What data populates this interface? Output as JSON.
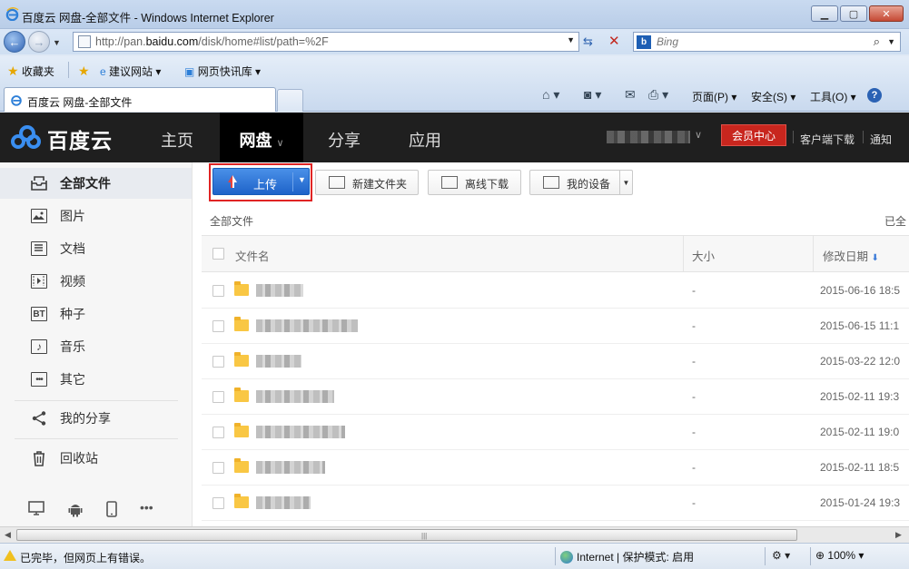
{
  "window": {
    "title": "百度云 网盘-全部文件 - Windows Internet Explorer",
    "min_label": "▁",
    "max_label": "▢",
    "close_label": "✕"
  },
  "address": {
    "url_prefix": "http://pan.",
    "url_host": "baidu.com",
    "url_rest": "/disk/home#list/path=%2F",
    "search_placeholder": "Bing"
  },
  "favorites": {
    "label": "收藏夹",
    "items": [
      "建议网站 ▾",
      "网页快讯库 ▾"
    ]
  },
  "tab": {
    "label": "百度云 网盘-全部文件"
  },
  "commandbar": {
    "page": "页面(P) ▾",
    "safety": "安全(S) ▾",
    "tools": "工具(O) ▾",
    "help": "?"
  },
  "site": {
    "brand": "百度云",
    "nav": [
      "主页",
      "网盘",
      "分享",
      "应用"
    ],
    "active_nav": "网盘",
    "vip_label": "会员中心",
    "client_download": "客户端下载",
    "notify": "通知"
  },
  "sidebar": {
    "items": [
      {
        "label": "全部文件",
        "icon": "folder-outline-icon",
        "active": true
      },
      {
        "label": "图片",
        "icon": "image-icon"
      },
      {
        "label": "文档",
        "icon": "document-icon"
      },
      {
        "label": "视频",
        "icon": "video-icon"
      },
      {
        "label": "种子",
        "icon": "bt-icon",
        "glyph": "BT"
      },
      {
        "label": "音乐",
        "icon": "music-icon"
      },
      {
        "label": "其它",
        "icon": "more-icon"
      },
      {
        "label": "我的分享",
        "icon": "share-icon"
      },
      {
        "label": "回收站",
        "icon": "trash-icon"
      }
    ]
  },
  "toolbar": {
    "upload": "上传",
    "new_folder": "新建文件夹",
    "offline_download": "离线下载",
    "my_devices": "我的设备"
  },
  "breadcrumb": "全部文件",
  "loaded_text": "已全",
  "table": {
    "col_name": "文件名",
    "col_size": "大小",
    "col_date": "修改日期",
    "rows": [
      {
        "size": "-",
        "date": "2015-06-16 18:5"
      },
      {
        "size": "-",
        "date": "2015-06-15 11:1"
      },
      {
        "size": "-",
        "date": "2015-03-22 12:0"
      },
      {
        "size": "-",
        "date": "2015-02-11 19:3"
      },
      {
        "size": "-",
        "date": "2015-02-11 19:0"
      },
      {
        "size": "-",
        "date": "2015-02-11 18:5"
      },
      {
        "size": "-",
        "date": "2015-01-24 19:3"
      }
    ]
  },
  "statusbar": {
    "text": "已完毕，但网页上有错误。",
    "zone": "Internet | 保护模式: 启用",
    "zoom": "100%"
  },
  "colors": {
    "accent_blue": "#1e63c9",
    "vip_red": "#c8261e",
    "folder_yellow": "#f9c744",
    "nav_bg": "#1f1f1f"
  }
}
